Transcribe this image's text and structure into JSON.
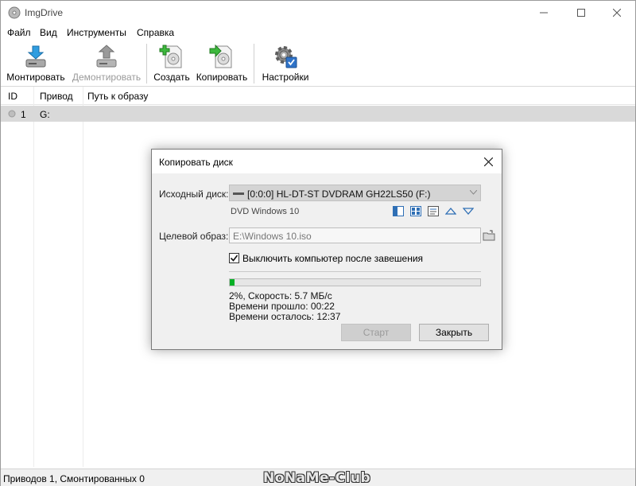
{
  "window": {
    "title": "ImgDrive"
  },
  "menu": [
    "Файл",
    "Вид",
    "Инструменты",
    "Справка"
  ],
  "toolbar": [
    {
      "label": "Монтировать",
      "icon": "mount-icon",
      "enabled": true
    },
    {
      "label": "Демонтировать",
      "icon": "unmount-icon",
      "enabled": false
    },
    {
      "label": "Создать",
      "icon": "create-image-icon",
      "enabled": true
    },
    {
      "label": "Копировать",
      "icon": "copy-disc-icon",
      "enabled": true
    },
    {
      "label": "Настройки",
      "icon": "settings-icon",
      "enabled": true
    }
  ],
  "list": {
    "columns": [
      "ID",
      "Привод",
      "Путь к образу"
    ],
    "rows": [
      {
        "id": "1",
        "drive": "G:",
        "path": ""
      }
    ]
  },
  "dialog": {
    "title": "Копировать диск",
    "source_label": "Исходный диск:",
    "source_value": "[0:0:0] HL-DT-ST DVDRAM GH22LS50 (F:)",
    "disc_label": "DVD Windows 10",
    "target_label": "Целевой образ:",
    "target_value": "E:\\Windows 10.iso",
    "shutdown_label": "Выключить компьютер после завешения",
    "shutdown_checked": true,
    "progress_percent": 2,
    "progress_text": "2%, Скорость: 5.7 МБ/с",
    "elapsed_text": "Времени прошло: 00:22",
    "remaining_text": "Времени осталось: 12:37",
    "start_label": "Старт",
    "close_label": "Закрыть"
  },
  "status": {
    "text": "Приводов 1, Смонтированных 0",
    "watermark": "NoNaMe-Club"
  },
  "colors": {
    "progress": "#06b025",
    "selected_row": "#d9d9d9"
  }
}
